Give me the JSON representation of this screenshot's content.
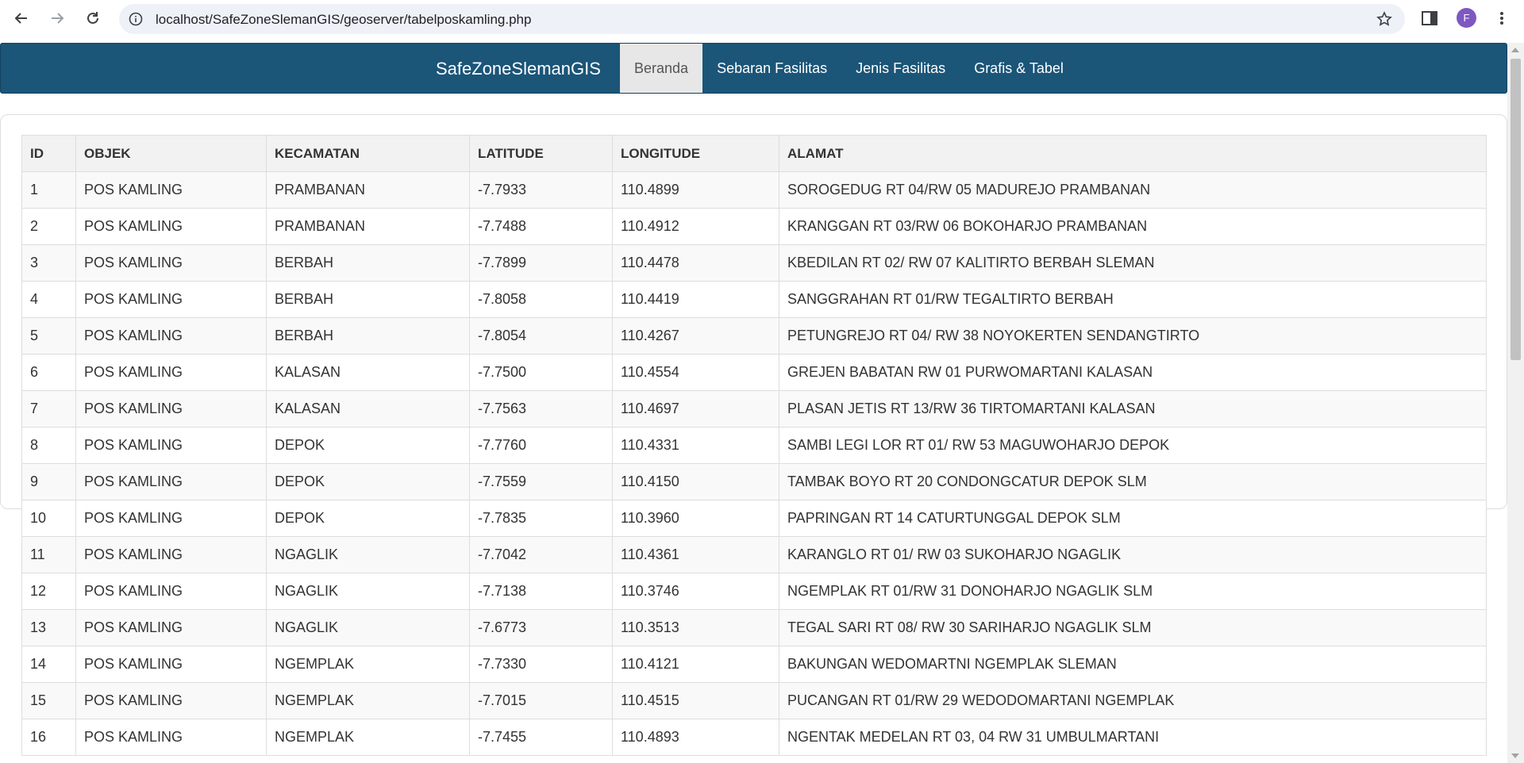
{
  "browser": {
    "url": "localhost/SafeZoneSlemanGIS/geoserver/tabelposkamling.php",
    "profile_initial": "F",
    "icons": [
      "back-icon",
      "forward-icon",
      "reload-icon",
      "info-icon",
      "star-icon",
      "side-panel-icon",
      "kebab-menu-icon"
    ]
  },
  "navbar": {
    "brand": "SafeZoneSlemanGIS",
    "items": [
      {
        "label": "Beranda",
        "active": true
      },
      {
        "label": "Sebaran Fasilitas",
        "active": false
      },
      {
        "label": "Jenis Fasilitas",
        "active": false
      },
      {
        "label": "Grafis & Tabel",
        "active": false
      }
    ]
  },
  "table": {
    "headers": [
      "ID",
      "OBJEK",
      "KECAMATAN",
      "LATITUDE",
      "LONGITUDE",
      "ALAMAT"
    ],
    "rows": [
      [
        "1",
        "POS KAMLING",
        "PRAMBANAN",
        "-7.7933",
        "110.4899",
        "SOROGEDUG RT 04/RW 05 MADUREJO PRAMBANAN"
      ],
      [
        "2",
        "POS KAMLING",
        "PRAMBANAN",
        "-7.7488",
        "110.4912",
        "KRANGGAN RT 03/RW 06 BOKOHARJO PRAMBANAN"
      ],
      [
        "3",
        "POS KAMLING",
        "BERBAH",
        "-7.7899",
        "110.4478",
        "KBEDILAN RT 02/ RW 07 KALITIRTO BERBAH SLEMAN"
      ],
      [
        "4",
        "POS KAMLING",
        "BERBAH",
        "-7.8058",
        "110.4419",
        "SANGGRAHAN RT 01/RW TEGALTIRTO BERBAH"
      ],
      [
        "5",
        "POS KAMLING",
        "BERBAH",
        "-7.8054",
        "110.4267",
        "PETUNGREJO RT 04/ RW 38 NOYOKERTEN SENDANGTIRTO"
      ],
      [
        "6",
        "POS KAMLING",
        "KALASAN",
        "-7.7500",
        "110.4554",
        "GREJEN BABATAN RW 01 PURWOMARTANI KALASAN"
      ],
      [
        "7",
        "POS KAMLING",
        "KALASAN",
        "-7.7563",
        "110.4697",
        "PLASAN JETIS RT 13/RW 36 TIRTOMARTANI KALASAN"
      ],
      [
        "8",
        "POS KAMLING",
        "DEPOK",
        "-7.7760",
        "110.4331",
        "SAMBI LEGI LOR RT 01/ RW 53 MAGUWOHARJO DEPOK"
      ],
      [
        "9",
        "POS KAMLING",
        "DEPOK",
        "-7.7559",
        "110.4150",
        "TAMBAK BOYO RT 20 CONDONGCATUR DEPOK SLM"
      ],
      [
        "10",
        "POS KAMLING",
        "DEPOK",
        "-7.7835",
        "110.3960",
        "PAPRINGAN RT 14 CATURTUNGGAL DEPOK SLM"
      ],
      [
        "11",
        "POS KAMLING",
        "NGAGLIK",
        "-7.7042",
        "110.4361",
        "KARANGLO RT 01/ RW 03 SUKOHARJO NGAGLIK"
      ],
      [
        "12",
        "POS KAMLING",
        "NGAGLIK",
        "-7.7138",
        "110.3746",
        "NGEMPLAK RT 01/RW 31 DONOHARJO NGAGLIK SLM"
      ],
      [
        "13",
        "POS KAMLING",
        "NGAGLIK",
        "-7.6773",
        "110.3513",
        "TEGAL SARI RT 08/ RW 30 SARIHARJO NGAGLIK SLM"
      ],
      [
        "14",
        "POS KAMLING",
        "NGEMPLAK",
        "-7.7330",
        "110.4121",
        "BAKUNGAN WEDOMARTNI NGEMPLAK SLEMAN"
      ],
      [
        "15",
        "POS KAMLING",
        "NGEMPLAK",
        "-7.7015",
        "110.4515",
        "PUCANGAN RT 01/RW 29 WEDODOMARTANI NGEMPLAK"
      ],
      [
        "16",
        "POS KAMLING",
        "NGEMPLAK",
        "-7.7455",
        "110.4893",
        "NGENTAK MEDELAN RT 03, 04 RW 31 UMBULMARTANI"
      ]
    ]
  },
  "colors": {
    "navbar_bg": "#1b5578",
    "nav_active_bg": "#e7e7e7",
    "avatar_bg": "#7e57c2"
  }
}
